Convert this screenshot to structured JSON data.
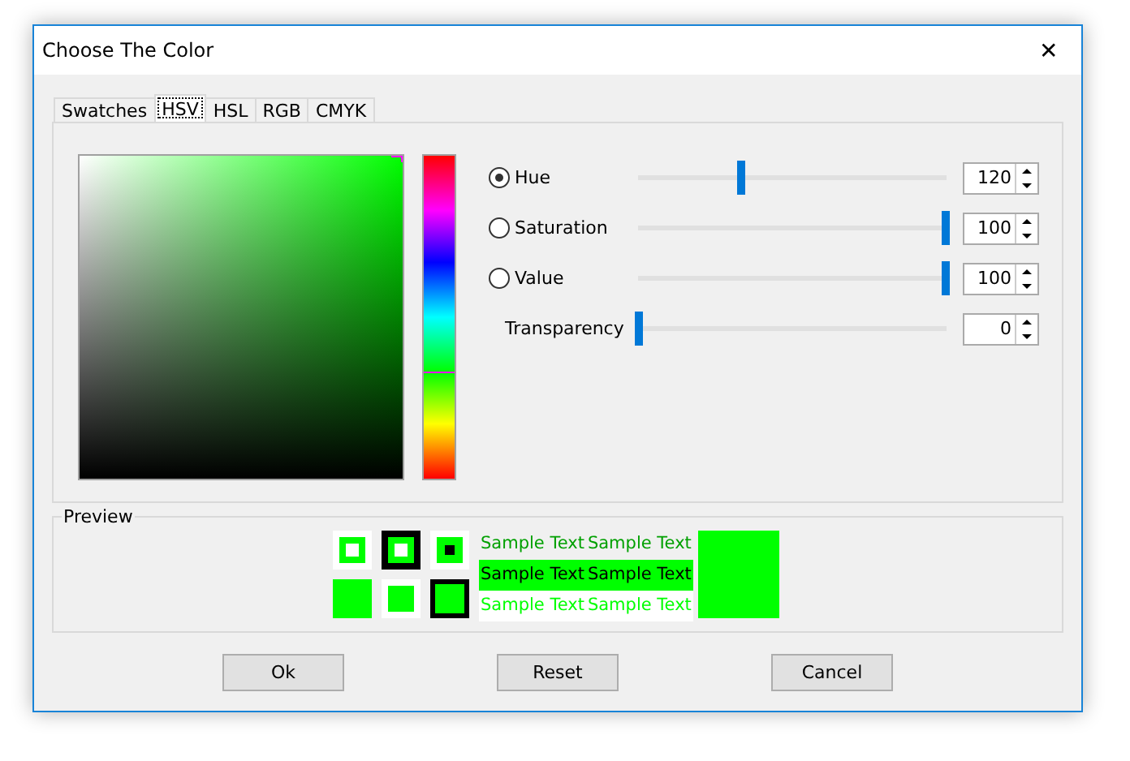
{
  "window": {
    "title": "Choose The Color",
    "close": "✕"
  },
  "tabs": [
    {
      "label": "Swatches",
      "selected": false
    },
    {
      "label": "HSV",
      "selected": true
    },
    {
      "label": "HSL",
      "selected": false
    },
    {
      "label": "RGB",
      "selected": false
    },
    {
      "label": "CMYK",
      "selected": false
    }
  ],
  "controls": [
    {
      "kind": "radio",
      "label": "Hue",
      "selected": true,
      "level": 0.333,
      "value": "120"
    },
    {
      "kind": "radio",
      "label": "Saturation",
      "selected": false,
      "level": 1,
      "value": "100"
    },
    {
      "kind": "radio",
      "label": "Value",
      "selected": false,
      "level": 1,
      "value": "100"
    },
    {
      "kind": "plain",
      "label": "Transparency",
      "level": 0,
      "value": "0"
    }
  ],
  "preview": {
    "title": "Preview",
    "samples": [
      "Sample Text",
      "Sample Text",
      "Sample Text",
      "Sample Text",
      "Sample Text",
      "Sample Text"
    ]
  },
  "buttons": [
    "Ok",
    "Reset",
    "Cancel"
  ]
}
